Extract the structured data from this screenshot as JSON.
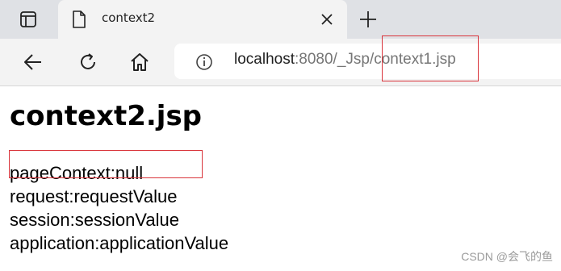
{
  "tab": {
    "title": "context2"
  },
  "address": {
    "host": "localhost",
    "path": ":8080/_Jsp/context1.jsp"
  },
  "page": {
    "heading": "context2.jsp",
    "lines": [
      "pageContext:null",
      "request:requestValue",
      "session:sessionValue",
      "application:applicationValue"
    ]
  },
  "watermark": "CSDN @会飞的鱼",
  "colors": {
    "highlight": "#d9343b",
    "tabbar": "#dfe1e5",
    "toolbar": "#f3f3f3"
  },
  "icons": [
    "window-icon",
    "page-icon",
    "close-icon",
    "plus-icon",
    "back-icon",
    "reload-icon",
    "home-icon",
    "info-icon"
  ]
}
